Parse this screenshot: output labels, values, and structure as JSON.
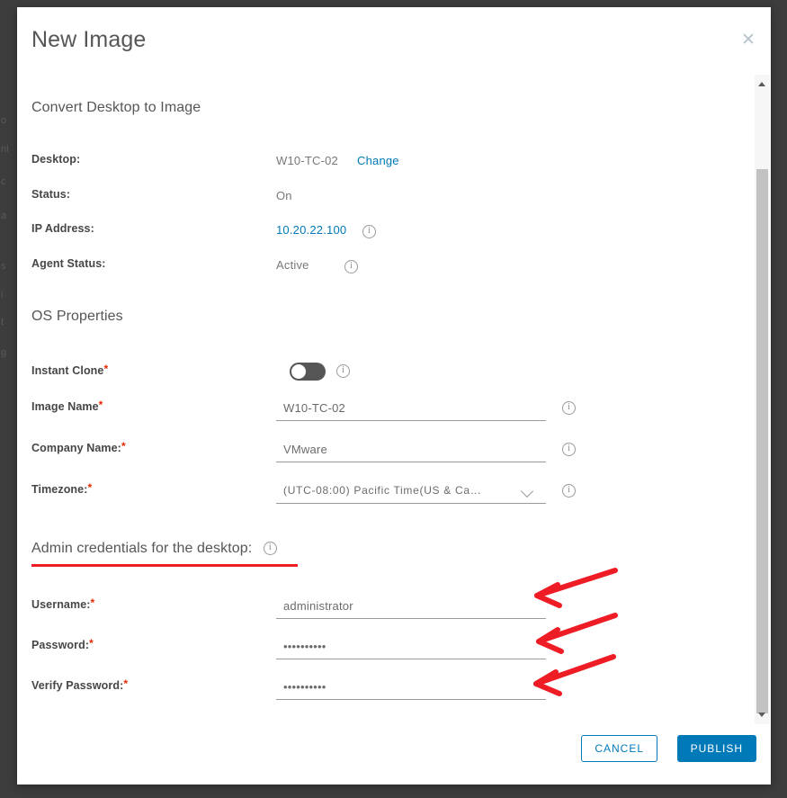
{
  "dialog": {
    "title": "New Image",
    "close_icon": "close-icon",
    "section_convert": "Convert Desktop to Image",
    "section_os": "OS Properties",
    "admin_heading": "Admin credentials for the desktop:",
    "info_icon": "info-icon"
  },
  "desktop_info": [
    {
      "label": "Desktop:",
      "value": "W10-TC-02",
      "link": "Change",
      "has_info": false,
      "value_is_link": false
    },
    {
      "label": "Status:",
      "value": "On",
      "link": "",
      "has_info": false,
      "value_is_link": false
    },
    {
      "label": "IP Address:",
      "value": "10.20.22.100",
      "link": "",
      "has_info": true,
      "value_is_link": true
    },
    {
      "label": "Agent Status:",
      "value": "Active",
      "link": "",
      "has_info": true,
      "value_is_link": false
    }
  ],
  "os_properties": {
    "instant_clone": {
      "label": "Instant Clone",
      "required": true,
      "enabled": false
    },
    "image_name": {
      "label": "Image Name",
      "required": true,
      "value": "W10-TC-02"
    },
    "company_name": {
      "label": "Company Name:",
      "required": true,
      "value": "VMware"
    },
    "timezone": {
      "label": "Timezone:",
      "required": true,
      "value": "(UTC-08:00) Pacific Time(US & Ca…"
    }
  },
  "credentials": {
    "username": {
      "label": "Username:",
      "required": true,
      "value": "administrator"
    },
    "password": {
      "label": "Password:",
      "required": true,
      "value": "••••••••••"
    },
    "verify_password": {
      "label": "Verify Password:",
      "required": true,
      "value": "••••••••••"
    }
  },
  "footer": {
    "cancel_label": "CANCEL",
    "publish_label": "PUBLISH"
  },
  "colors": {
    "accent": "#0079b8",
    "required": "#e62700",
    "annotation": "#ee1c25",
    "backdrop": "#3d3d3d"
  },
  "backdrop_slivers": [
    "o",
    "nl",
    "c",
    "a",
    "s",
    "i",
    "t",
    "g"
  ]
}
